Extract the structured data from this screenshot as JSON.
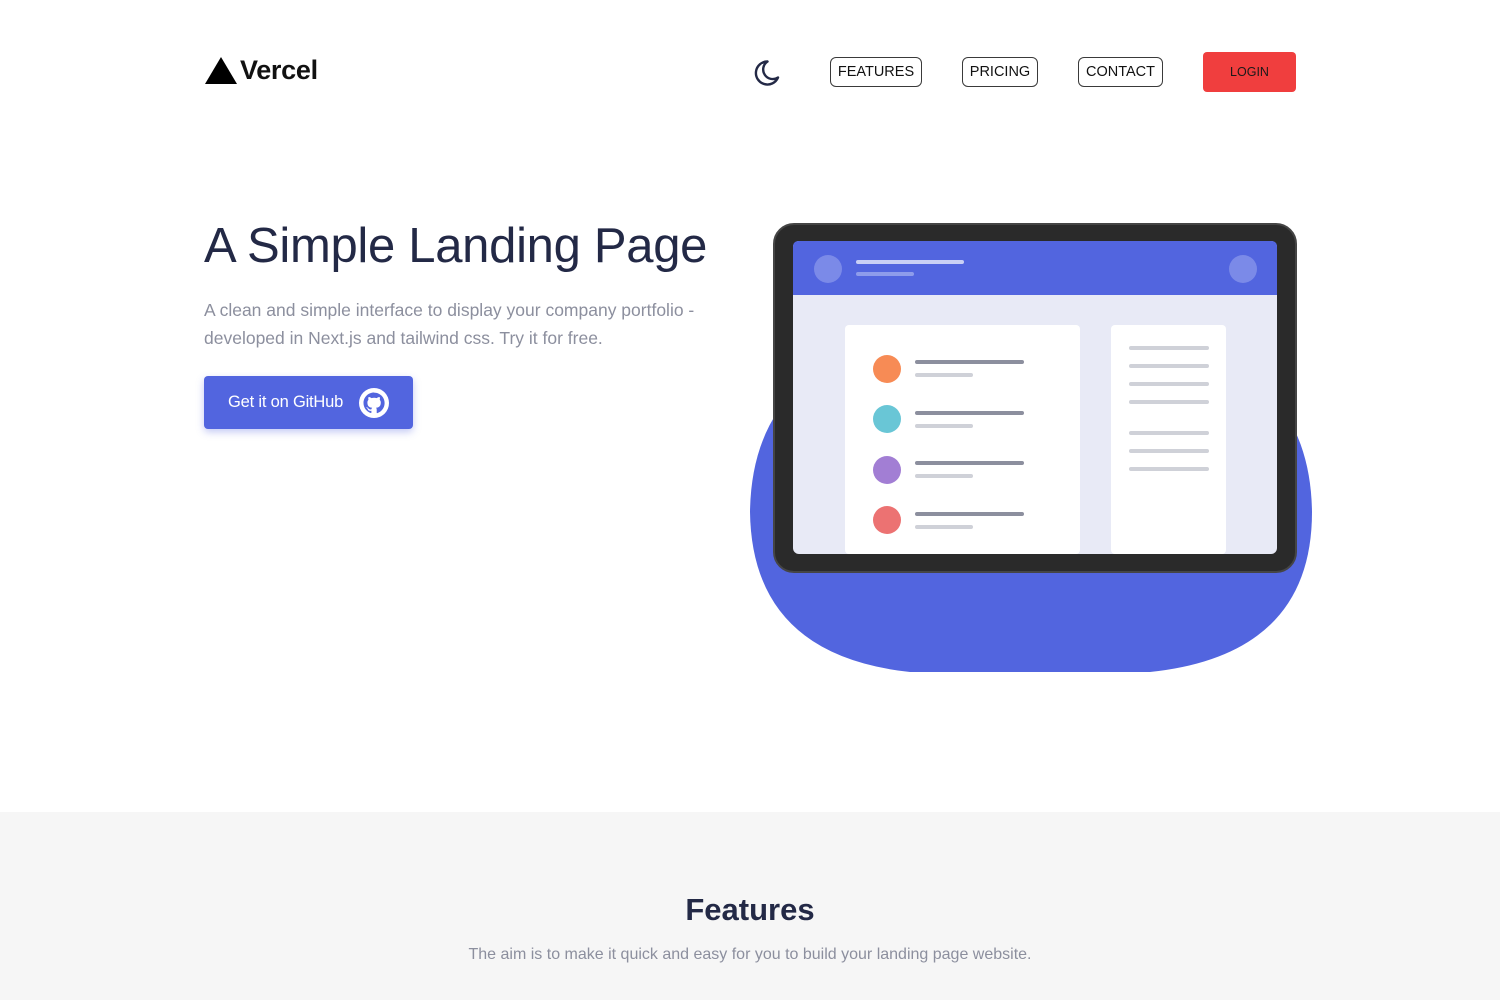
{
  "brand": {
    "name": "Vercel"
  },
  "nav": {
    "theme_toggle_icon": "moon-icon",
    "links": [
      {
        "label": "FEATURES"
      },
      {
        "label": "PRICING"
      },
      {
        "label": "CONTACT"
      }
    ],
    "login_label": "LOGIN"
  },
  "hero": {
    "title": "A Simple Landing Page",
    "subtitle": "A clean and simple interface to display your company portfolio - developed in Next.js and tailwind css. Try it for free.",
    "cta_label": "Get it on GitHub",
    "cta_icon": "github-icon"
  },
  "features": {
    "title": "Features",
    "subtitle": "The aim is to make it quick and easy for you to build your landing page website."
  },
  "colors": {
    "accent": "#5265df",
    "login": "#f03e3e",
    "heading": "#232946",
    "muted": "#8c8f9e",
    "list_dots": [
      "#f78b55",
      "#69c6d6",
      "#a27ed4",
      "#ec7272"
    ]
  }
}
